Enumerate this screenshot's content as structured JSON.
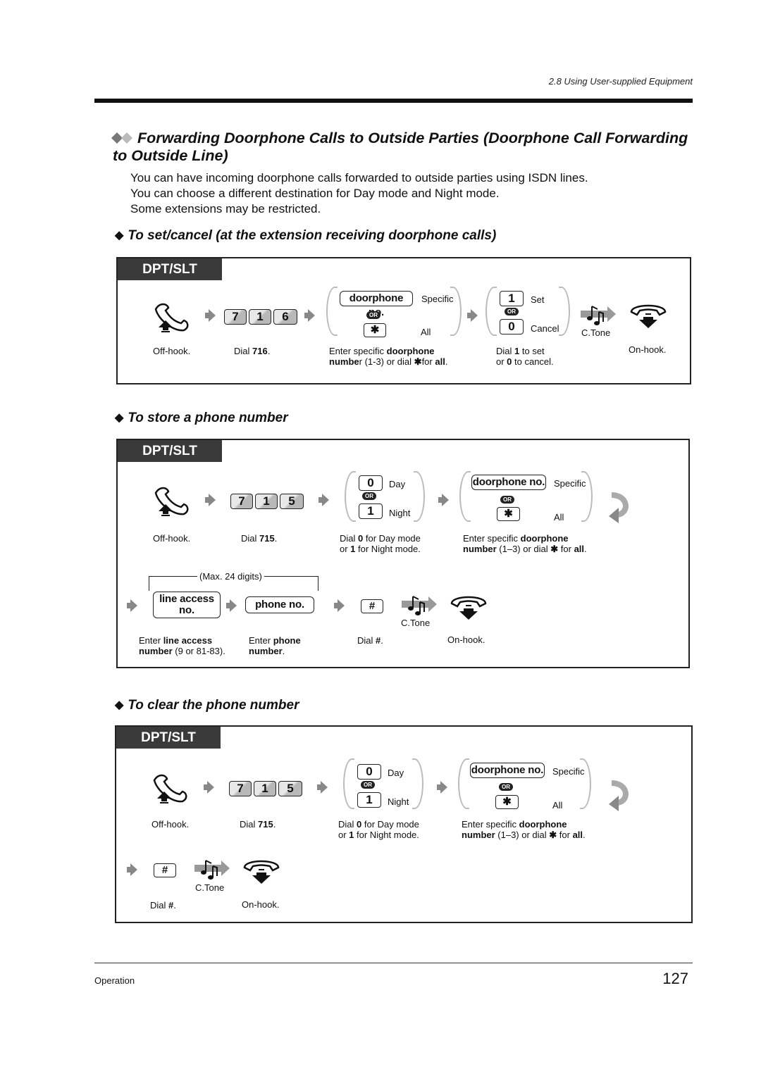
{
  "header": {
    "section": "2.8   Using User-supplied Equipment"
  },
  "title": {
    "line1": "Forwarding Doorphone Calls to Outside Parties (Doorphone Call Forwarding",
    "line2": "to Outside Line)"
  },
  "intro": [
    "You can have incoming doorphone calls forwarded to outside parties using ISDN lines.",
    "You can choose a different destination for Day mode and Night mode.",
    "Some extensions may be restricted."
  ],
  "common": {
    "tag": "DPT/SLT",
    "or": "OR",
    "ctone": "C.Tone",
    "doorphone_no": "doorphone no.",
    "specific": "Specific",
    "all": "All",
    "star": "✱",
    "day": "Day",
    "night": "Night",
    "hash": "#",
    "off_hook": "Off-hook.",
    "on_hook": "On-hook."
  },
  "sections": [
    {
      "heading": "To set/cancel (at the extension receiving doorphone calls)",
      "dial_keys": [
        "7",
        "1",
        "6"
      ],
      "dial_caption_pre": "Dial ",
      "dial_caption_num": "716",
      "doorphone_caption": {
        "a": "Enter specific ",
        "b": "doorphone",
        "c": "numbe",
        "d": "r (1-3) or dial  ",
        "e": "✱",
        "f": "for ",
        "g": "all",
        "h": "."
      },
      "set_keys": {
        "set_key": "1",
        "set_label": "Set",
        "cancel_key": "0",
        "cancel_label": "Cancel"
      },
      "set_caption": {
        "l1a": "Dial ",
        "l1b": "1",
        "l1c": " to set",
        "l2a": "or ",
        "l2b": "0",
        "l2c": " to cancel."
      }
    },
    {
      "heading": "To store a phone number",
      "dial_keys": [
        "7",
        "1",
        "5"
      ],
      "dial_caption_pre": "Dial ",
      "dial_caption_num": "715",
      "mode_keys": {
        "day_key": "0",
        "night_key": "1"
      },
      "mode_caption": {
        "l1a": "Dial ",
        "l1b": "0",
        "l1c": " for Day mode",
        "l2a": "or ",
        "l2b": "1",
        "l2c": " for Night mode."
      },
      "doorphone_caption": {
        "a": "Enter specific ",
        "b": "doorphone",
        "c": "number",
        "d": " (1–3) or dial ",
        "e": "✱",
        "f": " for ",
        "g": "all",
        "h": "."
      },
      "max_digits": "(Max. 24 digits)",
      "line_access_box": [
        "line access",
        "no."
      ],
      "phone_no_box": "phone no.",
      "line_access_caption": {
        "l1a": "Enter ",
        "l1b": "line access",
        "l2a": "number",
        "l2b": " (9 or 81-83)."
      },
      "phone_caption": {
        "l1a": "Enter ",
        "l1b": "phone",
        "l2a": "number",
        "l2b": "."
      },
      "hash_caption": {
        "a": "Dial ",
        "b": "#",
        "c": "."
      }
    },
    {
      "heading": "To clear the phone number",
      "dial_keys": [
        "7",
        "1",
        "5"
      ],
      "dial_caption_pre": "Dial ",
      "dial_caption_num": "715",
      "mode_keys": {
        "day_key": "0",
        "night_key": "1"
      },
      "mode_caption": {
        "l1a": "Dial ",
        "l1b": "0",
        "l1c": " for Day mode",
        "l2a": "or ",
        "l2b": "1",
        "l2c": " for Night mode."
      },
      "doorphone_caption": {
        "a": "Enter specific ",
        "b": "doorphone",
        "c": "number",
        "d": " (1–3) or dial ",
        "e": "✱",
        "f": " for ",
        "g": "all",
        "h": "."
      },
      "hash_caption": {
        "a": "Dial ",
        "b": "#",
        "c": "."
      }
    }
  ],
  "footer": {
    "left": "Operation",
    "page": "127"
  }
}
